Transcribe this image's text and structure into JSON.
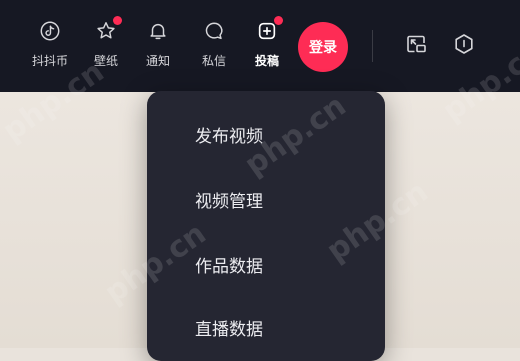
{
  "nav": {
    "items": [
      {
        "label": "抖抖币",
        "icon": "tiktok-coin-icon"
      },
      {
        "label": "壁纸",
        "icon": "wallpaper-icon",
        "badge": true
      },
      {
        "label": "通知",
        "icon": "bell-icon"
      },
      {
        "label": "私信",
        "icon": "message-icon"
      },
      {
        "label": "投稿",
        "icon": "upload-plus-icon",
        "badge": true
      }
    ],
    "login_label": "登录",
    "tools": [
      {
        "icon": "picture-in-picture-icon"
      },
      {
        "icon": "hexagon-info-icon"
      }
    ]
  },
  "dropdown": {
    "items": [
      "发布视频",
      "视频管理",
      "作品数据",
      "直播数据"
    ]
  },
  "watermark": {
    "text": "php.cn"
  },
  "colors": {
    "topbar": "#161823",
    "accent": "#fe2c55",
    "dropdown_bg": "#252632",
    "page_bg": "#e9e3dc"
  }
}
